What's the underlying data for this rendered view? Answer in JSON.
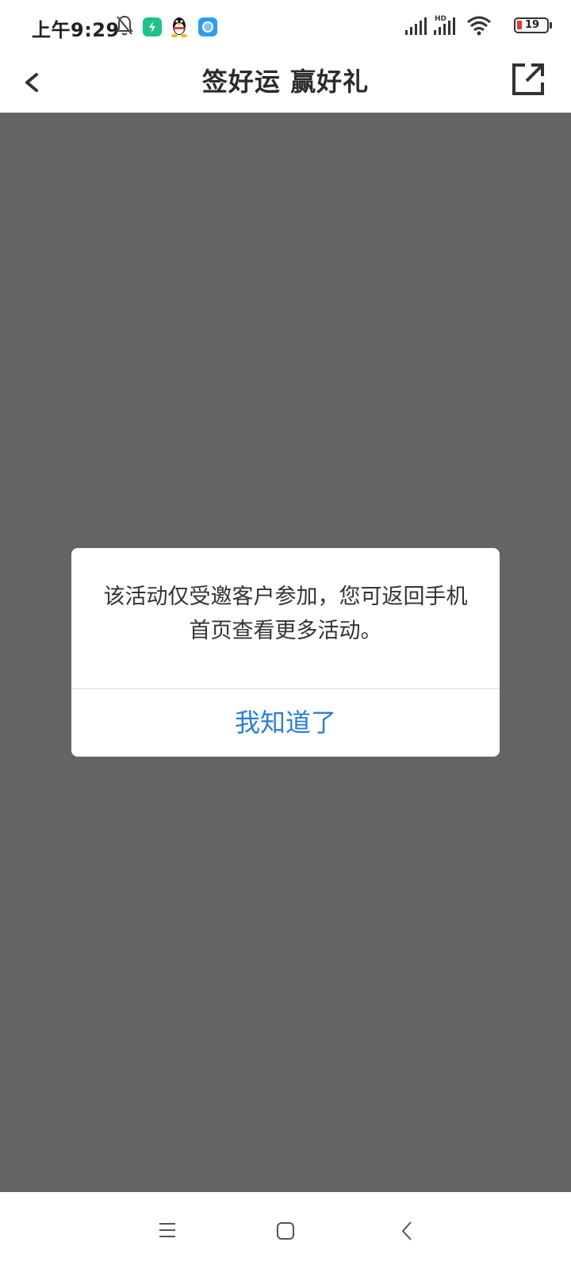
{
  "status_bar": {
    "time": "上午9:29",
    "battery_level": "19",
    "network_label": "HD",
    "icons": [
      "mute-icon",
      "green-app-icon",
      "qq-icon",
      "blue-app-icon",
      "signal-icon",
      "hd-signal-icon",
      "wifi-icon",
      "battery-icon"
    ]
  },
  "nav_bar": {
    "title": "签好运 赢好礼",
    "back_icon": "chevron-left-icon",
    "share_icon": "share-icon"
  },
  "dialog": {
    "message": "该活动仅受邀客户参加，您可返回手机首页查看更多活动。",
    "button_label": "我知道了"
  },
  "colors": {
    "overlay": "#636466",
    "dialog_button": "#2b7fd3",
    "battery_low": "#e53935"
  },
  "system_nav": {
    "icons": [
      "menu-icon",
      "home-icon",
      "back-icon"
    ]
  }
}
